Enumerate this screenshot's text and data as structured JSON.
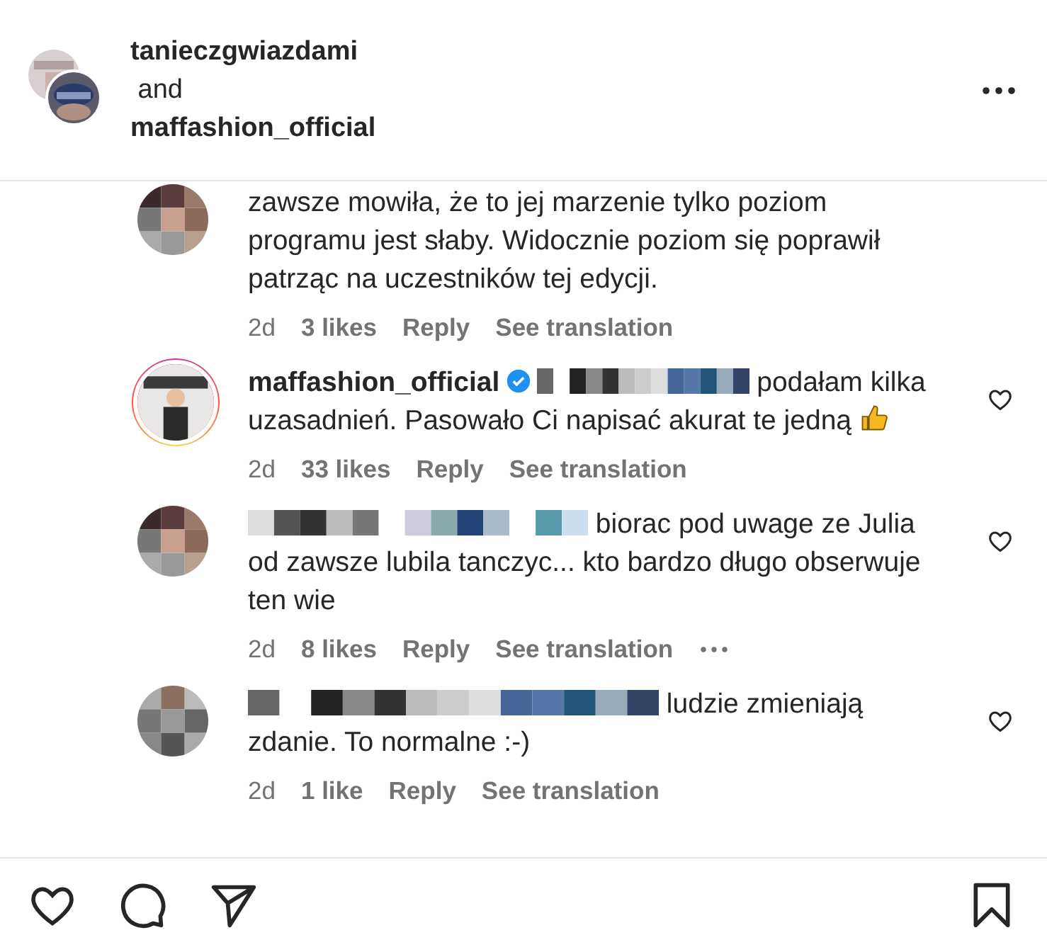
{
  "header": {
    "authors": [
      "tanieczgwiazdami",
      "maffashion_official"
    ],
    "joiner": "and"
  },
  "comments": [
    {
      "text": "zawsze mowiła, że to jej marzenie tylko poziom programu jest słaby. Widocznie poziom się poprawił patrząc na uczestników tej edycji.",
      "time": "2d",
      "likes": "3 likes",
      "reply": "Reply",
      "translation": "See translation",
      "more": false,
      "heart": false,
      "author_blurred": false,
      "story_ring": false,
      "thumbs_up": false
    },
    {
      "author": "maffashion_official",
      "verified": true,
      "author_blurred": false,
      "mention_blurred": true,
      "text": "podałam kilka uzasadnień. Pasowało Ci napisać akurat te jedną",
      "thumbs_up": true,
      "time": "2d",
      "likes": "33 likes",
      "reply": "Reply",
      "translation": "See translation",
      "more": false,
      "heart": true,
      "story_ring": true
    },
    {
      "author_blurred": true,
      "text": "biorac pod uwage ze Julia od zawsze lubila tanczyc... kto bardzo długo obserwuje ten wie",
      "time": "2d",
      "likes": "8 likes",
      "reply": "Reply",
      "translation": "See translation",
      "more": true,
      "heart": true,
      "story_ring": false,
      "thumbs_up": false
    },
    {
      "author_blurred": true,
      "text": "ludzie zmieniają zdanie. To normalne :-)",
      "time": "2d",
      "likes": "1 like",
      "reply": "Reply",
      "translation": "See translation",
      "more": false,
      "heart": true,
      "story_ring": false,
      "thumbs_up": false
    }
  ]
}
